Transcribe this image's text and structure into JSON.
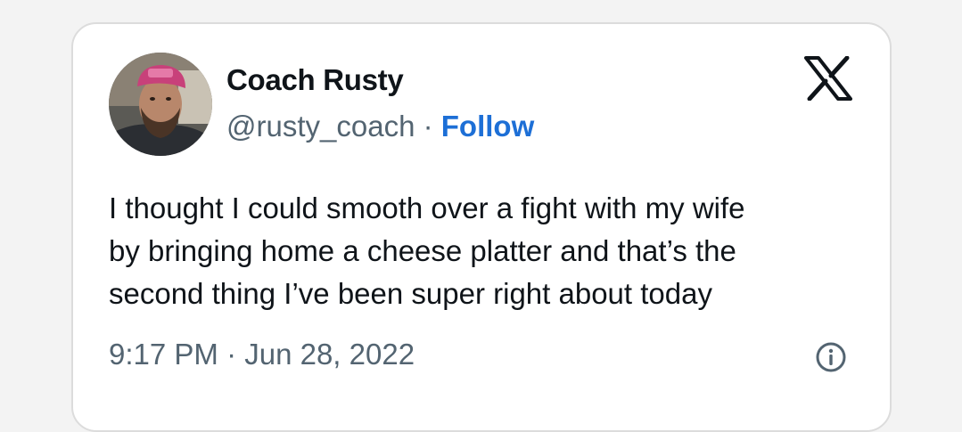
{
  "tweet": {
    "author": {
      "name": "Coach Rusty",
      "handle": "@rusty_coach",
      "separator": " · ",
      "follow_label": "Follow"
    },
    "text": "I thought I could smooth over a fight with my wife\nby bringing home a cheese platter and that’s the\nsecond thing I’ve been super right about today",
    "timestamp": "9:17 PM · Jun 28, 2022",
    "icons": {
      "brand": "x-logo-icon",
      "info": "info-icon",
      "avatar": "avatar-photo"
    },
    "colors": {
      "follow": "#1d6fd6",
      "secondary_text": "#536471",
      "primary_text": "#0f1419"
    }
  }
}
